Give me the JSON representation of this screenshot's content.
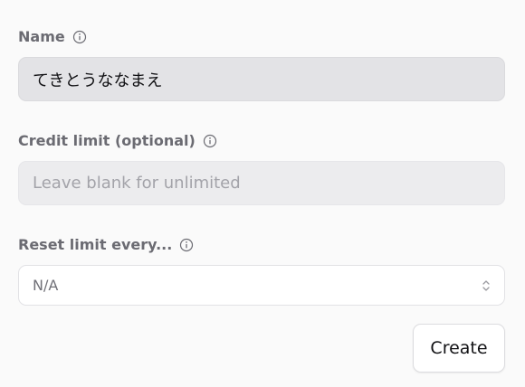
{
  "form": {
    "name": {
      "label": "Name",
      "value": "てきとうななまえ",
      "icon": "info-icon"
    },
    "credit_limit": {
      "label": "Credit limit (optional)",
      "placeholder": "Leave blank for unlimited",
      "icon": "info-icon"
    },
    "reset_limit": {
      "label": "Reset limit every...",
      "selected": "N/A",
      "icon": "info-icon"
    },
    "create_label": "Create"
  },
  "colors": {
    "background": "#fafafa",
    "label": "#6b6b72",
    "name_input_bg": "#e3e3e6",
    "credit_input_bg": "#ececee"
  }
}
